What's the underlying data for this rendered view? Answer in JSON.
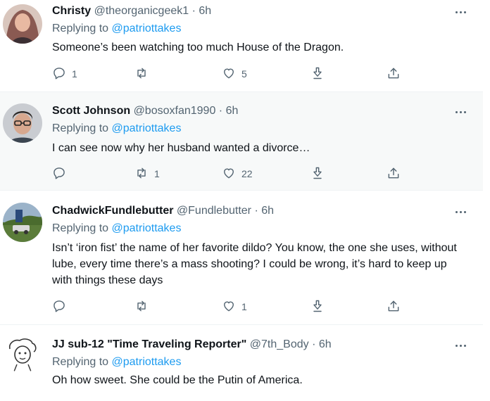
{
  "replying_label": "Replying to",
  "tweets": [
    {
      "name": "Christy",
      "handle": "@theorganicgeek1",
      "dot": "·",
      "time": "6h",
      "mention": "@patriottakes",
      "text": "Someone’s been watching too much House of the Dragon.",
      "replies": "1",
      "retweets": "",
      "likes": "5"
    },
    {
      "name": "Scott Johnson",
      "handle": "@bosoxfan1990",
      "dot": "·",
      "time": "6h",
      "mention": "@patriottakes",
      "text": "I can see now why her husband wanted a divorce…",
      "replies": "",
      "retweets": "1",
      "likes": "22"
    },
    {
      "name": "ChadwickFundlebutter",
      "handle": "@Fundlebutter",
      "dot": "·",
      "time": "6h",
      "mention": "@patriottakes",
      "text": "Isn’t ‘iron fist’ the name of her favorite dildo? You know, the one she uses, without lube, every time there’s a mass shooting? I could be wrong, it’s hard to keep up with things these days",
      "replies": "",
      "retweets": "",
      "likes": "1"
    },
    {
      "name": "JJ sub-12 \"Time Traveling Reporter\"",
      "handle": "@7th_Body",
      "dot": "·",
      "time": "6h",
      "mention": "@patriottakes",
      "text": "Oh how sweet. She could be the Putin of America."
    }
  ],
  "colors": {
    "mention": "#1d9bf0",
    "secondary_text": "#536471",
    "highlight_bg": "#f7f9f9",
    "divider": "#eff3f4"
  },
  "icons": {
    "reply": "speech-bubble-icon",
    "retweet": "retweet-icon",
    "like": "heart-icon",
    "download": "download-icon",
    "share": "share-icon",
    "more": "more-dots-icon"
  }
}
